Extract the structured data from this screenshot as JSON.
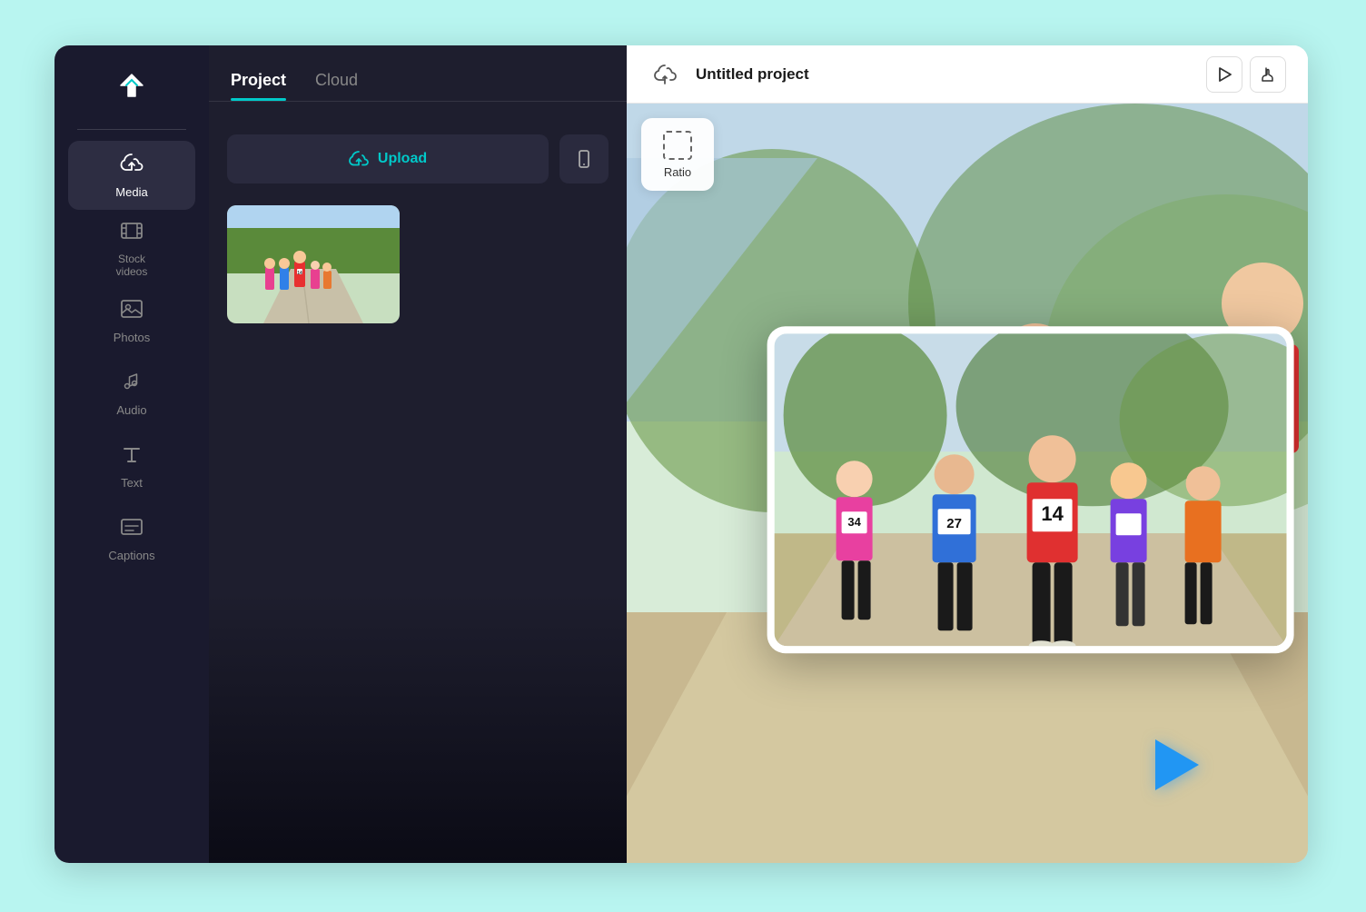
{
  "app": {
    "logo_alt": "CapCut logo",
    "background_color": "#b8f5f0"
  },
  "sidebar": {
    "items": [
      {
        "id": "media",
        "label": "Media",
        "icon": "cloud-upload",
        "active": true
      },
      {
        "id": "stock-videos",
        "label": "Stock\nvideos",
        "icon": "film",
        "active": false
      },
      {
        "id": "photos",
        "label": "Photos",
        "icon": "image",
        "active": false
      },
      {
        "id": "audio",
        "label": "Audio",
        "icon": "music-note",
        "active": false
      },
      {
        "id": "text",
        "label": "Text",
        "icon": "text-cursor",
        "active": false
      },
      {
        "id": "captions",
        "label": "Captions",
        "icon": "caption",
        "active": false
      }
    ]
  },
  "media_panel": {
    "tabs": [
      {
        "id": "project",
        "label": "Project",
        "active": true
      },
      {
        "id": "cloud",
        "label": "Cloud",
        "active": false
      }
    ],
    "upload_button_label": "Upload",
    "mobile_icon": "mobile",
    "thumbnail_count": 1
  },
  "editor": {
    "project_title": "Untitled project",
    "ratio_label": "Ratio",
    "play_button_title": "Play",
    "cursor_button_title": "Cursor"
  },
  "toolbar": {
    "upload_icon": "upload-cloud",
    "play_icon": "play-arrow",
    "hand_icon": "hand-cursor"
  },
  "colors": {
    "accent": "#00c9c9",
    "sidebar_bg": "#1a1a2e",
    "panel_bg": "#1e1e2e",
    "play_cursor": "#2196F3",
    "header_bg": "#ffffff"
  }
}
